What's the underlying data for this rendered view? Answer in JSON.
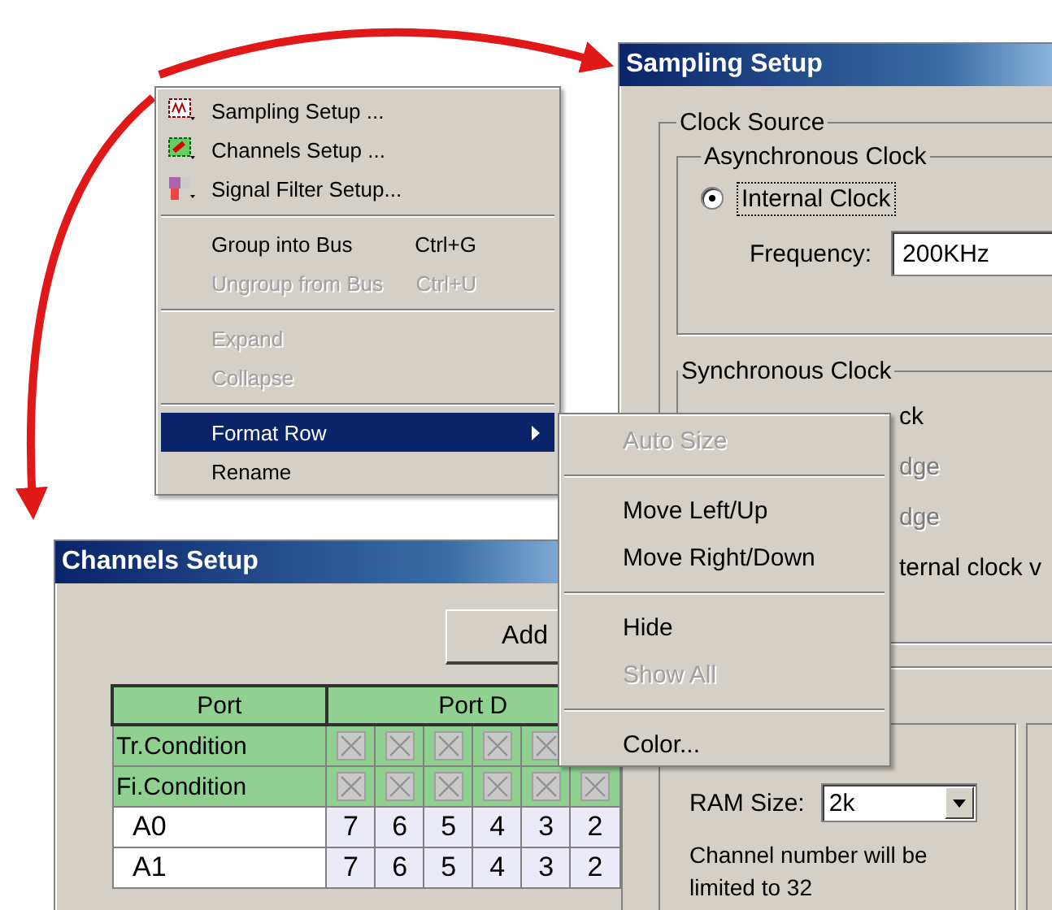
{
  "context_menu": {
    "groups": [
      [
        {
          "label": "Sampling Setup ...",
          "disabled": false,
          "selected": false
        },
        {
          "label": "Channels Setup ...",
          "disabled": false,
          "selected": false
        },
        {
          "label": "Signal Filter Setup...",
          "disabled": false,
          "selected": false
        }
      ],
      [
        {
          "label": "Group into Bus",
          "shortcut": "Ctrl+G",
          "disabled": false,
          "selected": false
        },
        {
          "label": "Ungroup from Bus",
          "shortcut": "Ctrl+U",
          "disabled": true,
          "selected": false
        }
      ],
      [
        {
          "label": "Expand",
          "disabled": true,
          "selected": false
        },
        {
          "label": "Collapse",
          "disabled": true,
          "selected": false
        }
      ],
      [
        {
          "label": "Format Row",
          "disabled": false,
          "selected": true,
          "submenu": true
        },
        {
          "label": "Rename",
          "disabled": false,
          "selected": false
        }
      ]
    ]
  },
  "submenu": {
    "groups": [
      [
        {
          "label": "Auto Size",
          "disabled": true
        }
      ],
      [
        {
          "label": "Move Left/Up",
          "disabled": false
        },
        {
          "label": "Move Right/Down",
          "disabled": false
        }
      ],
      [
        {
          "label": "Hide",
          "disabled": false
        },
        {
          "label": "Show All",
          "disabled": true
        }
      ],
      [
        {
          "label": "Color...",
          "disabled": false
        }
      ]
    ]
  },
  "sampling_setup": {
    "title": "Sampling Setup",
    "clock_source": "Clock Source",
    "async_clock": "Asynchronous Clock",
    "internal_clock": {
      "label": "Internal Clock",
      "selected": true
    },
    "frequency_label": "Frequency:",
    "frequency_value": "200KHz",
    "sync_clock": "Synchronous Clock",
    "partial_lines": [
      {
        "text": "ck",
        "disabled": false
      },
      {
        "text": "dge",
        "disabled": true
      },
      {
        "text": "dge",
        "disabled": true
      },
      {
        "text": "ternal clock v",
        "disabled": false
      }
    ],
    "ram_label": "RAM Size:",
    "ram_value": "2k",
    "note": "Channel number will be limited to 32"
  },
  "channels_setup": {
    "title": "Channels Setup",
    "add_button": "Add",
    "columns": [
      "Port",
      "Port D"
    ],
    "condition_rows": [
      {
        "label": "Tr.Condition",
        "cells": [
          {
            "checked": true
          },
          {
            "checked": true
          },
          {
            "checked": true
          },
          {
            "checked": true
          },
          {
            "checked": true
          }
        ]
      },
      {
        "label": "Fi.Condition",
        "cells": [
          {
            "checked": true
          },
          {
            "checked": true
          },
          {
            "checked": true
          },
          {
            "checked": true
          },
          {
            "checked": true
          },
          {
            "checked": true
          }
        ]
      }
    ],
    "rows": [
      {
        "label": "A0",
        "values": [
          "7",
          "6",
          "5",
          "4",
          "3",
          "2"
        ]
      },
      {
        "label": "A1",
        "values": [
          "7",
          "6",
          "5",
          "4",
          "3",
          "2"
        ]
      }
    ]
  }
}
